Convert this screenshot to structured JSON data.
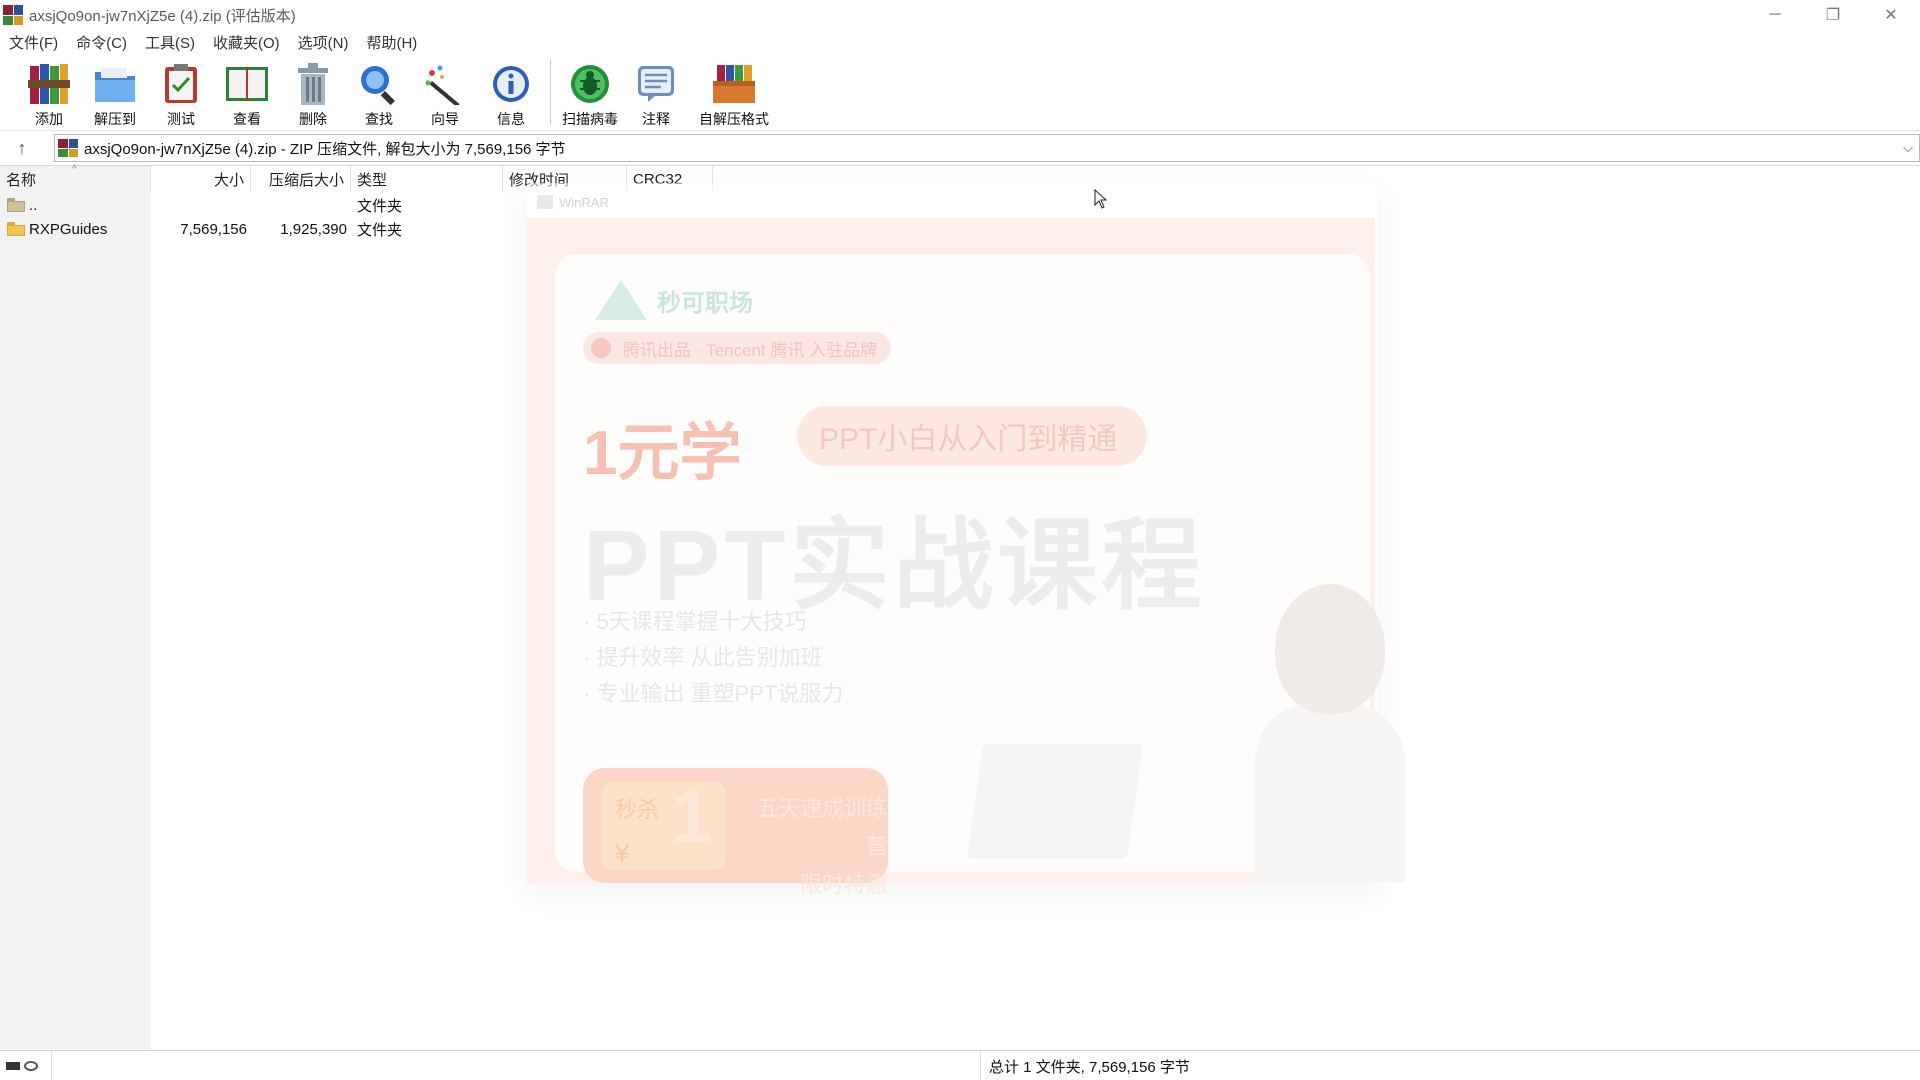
{
  "window": {
    "title": "axsjQo9on-jw7nXjZ5e (4).zip (评估版本)",
    "controls": {
      "minimize": "─",
      "restore": "❐",
      "close": "✕"
    }
  },
  "menu": [
    "文件(F)",
    "命令(C)",
    "工具(S)",
    "收藏夹(O)",
    "选项(N)",
    "帮助(H)"
  ],
  "toolbar": {
    "add": "添加",
    "extract_to": "解压到",
    "test": "测试",
    "view": "查看",
    "delete": "删除",
    "find": "查找",
    "wizard": "向导",
    "info": "信息",
    "virus_scan": "扫描病毒",
    "comment": "注释",
    "sfx": "自解压格式"
  },
  "address": {
    "up_icon": "↑",
    "text": "axsjQo9on-jw7nXjZ5e (4).zip - ZIP 压缩文件, 解包大小为 7,569,156 字节",
    "dropdown_icon": "⌵"
  },
  "columns": {
    "name": "名称",
    "size": "大小",
    "packed": "压缩后大小",
    "type": "类型",
    "modified": "修改时间",
    "crc": "CRC32"
  },
  "rows": [
    {
      "name": "..",
      "size": "",
      "packed": "",
      "type": "文件夹"
    },
    {
      "name": "RXPGuides",
      "size": "7,569,156",
      "packed": "1,925,390",
      "type": "文件夹"
    }
  ],
  "ad": {
    "header": "WinRAR",
    "brand": "秒可职场",
    "pill": "腾讯出品 · Tencent 腾讯 入驻品牌",
    "price": "1元学",
    "subtitle": "PPT小白从入门到精通",
    "title": "PPT实战课程",
    "bullets": [
      "· 5天课程掌握十大技巧",
      "· 提升效率 从此告别加班",
      "· 专业输出 重塑PPT说服力"
    ],
    "button_left": "秒杀",
    "button_currency": "¥",
    "button_amount": "1",
    "button_line1": "五天速成训练营",
    "button_line2": "限时特惠"
  },
  "status": {
    "summary": "总计 1 文件夹, 7,569,156 字节"
  },
  "colors": {
    "accent_folder": "#f2c558",
    "ad_tint": "#fdf0ea"
  }
}
